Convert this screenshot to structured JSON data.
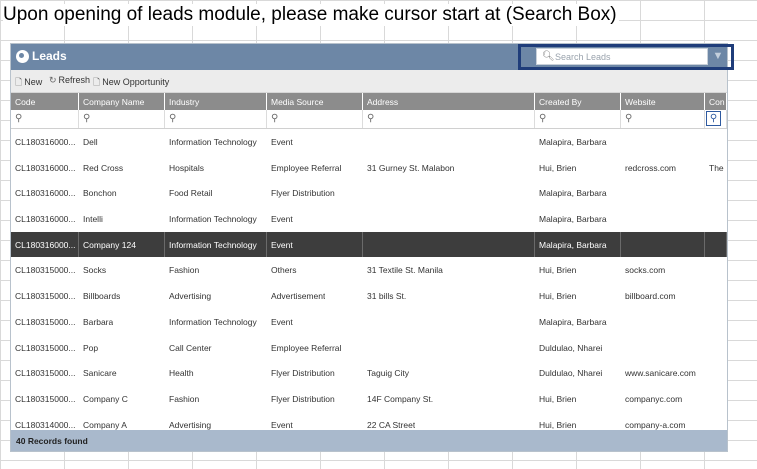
{
  "caption": "Upon opening of leads module, please make cursor start at (Search Box)",
  "window": {
    "title": "Leads"
  },
  "search": {
    "placeholder": "Search Leads",
    "value": ""
  },
  "toolbar": {
    "new_label": "New",
    "refresh_label": "Refresh",
    "new_opportunity_label": "New Opportunity"
  },
  "columns": [
    "Code",
    "Company Name",
    "Industry",
    "Media Source",
    "Address",
    "Created By",
    "Website",
    "Con"
  ],
  "rows": [
    [
      "CL180316000...",
      "Dell",
      "Information Technology",
      "Event",
      "",
      "Malapira, Barbara",
      "",
      ""
    ],
    [
      "CL180316000...",
      "Red Cross",
      "Hospitals",
      "Employee Referral",
      "31 Gurney St. Malabon",
      "Hui, Brien",
      "redcross.com",
      "The"
    ],
    [
      "CL180316000...",
      "Bonchon",
      "Food Retail",
      "Flyer Distribution",
      "",
      "Malapira, Barbara",
      "",
      ""
    ],
    [
      "CL180316000...",
      "Intelli",
      "Information Technology",
      "Event",
      "",
      "Malapira, Barbara",
      "",
      ""
    ],
    [
      "CL180316000...",
      "Company 124",
      "Information Technology",
      "Event",
      "",
      "Malapira, Barbara",
      "",
      ""
    ],
    [
      "CL180315000...",
      "Socks",
      "Fashion",
      "Others",
      "31 Textile St. Manila",
      "Hui, Brien",
      "socks.com",
      ""
    ],
    [
      "CL180315000...",
      "Billboards",
      "Advertising",
      "Advertisement",
      "31 bills St.",
      "Hui, Brien",
      "billboard.com",
      ""
    ],
    [
      "CL180315000...",
      "Barbara",
      "Information Technology",
      "Event",
      "",
      "Malapira, Barbara",
      "",
      ""
    ],
    [
      "CL180315000...",
      "Pop",
      "Call Center",
      "Employee Referral",
      "",
      "Duldulao, Nharei",
      "",
      ""
    ],
    [
      "CL180315000...",
      "Sanicare",
      "Health",
      "Flyer Distribution",
      "Taguig City",
      "Duldulao, Nharei",
      "www.sanicare.com",
      ""
    ],
    [
      "CL180315000...",
      "Company C",
      "Fashion",
      "Flyer Distribution",
      "14F Company St.",
      "Hui, Brien",
      "companyc.com",
      ""
    ],
    [
      "CL180314000...",
      "Company A",
      "Advertising",
      "Event",
      "22 CA Street",
      "Hui, Brien",
      "company-a.com",
      ""
    ]
  ],
  "selected_row": 4,
  "status": {
    "records_text": "40 Records found"
  },
  "colors": {
    "title_bar": "#6d87a6",
    "header": "#8c8c8c",
    "selected_row": "#3d3d3d",
    "status_bar": "#a9b9cc",
    "highlight_border": "#1f3d7a"
  },
  "icons": {
    "logo": "leads-logo-icon",
    "search": "search-icon",
    "filter": "filter-icon",
    "new": "new-document-icon",
    "refresh": "refresh-icon",
    "new_opportunity": "document-icon"
  }
}
